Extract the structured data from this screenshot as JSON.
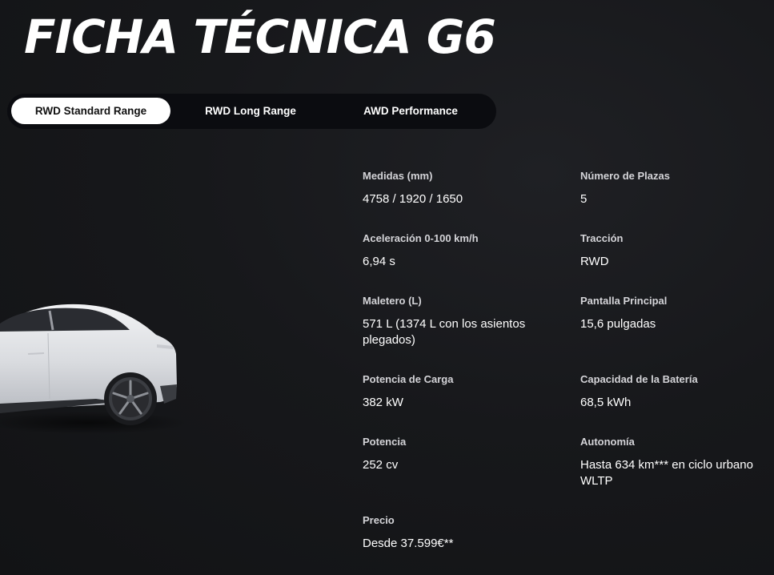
{
  "page": {
    "title": "FICHA TÉCNICA G6"
  },
  "tabs": [
    {
      "label": "RWD Standard Range",
      "active": true
    },
    {
      "label": "RWD Long Range",
      "active": false
    },
    {
      "label": "AWD Performance",
      "active": false
    }
  ],
  "specs": {
    "medidas": {
      "label": "Medidas (mm)",
      "value": "4758 / 1920 / 1650"
    },
    "plazas": {
      "label": "Número de Plazas",
      "value": "5"
    },
    "aceleracion": {
      "label": "Aceleración 0-100 km/h",
      "value": "6,94 s"
    },
    "traccion": {
      "label": "Tracción",
      "value": "RWD"
    },
    "maletero": {
      "label": "Maletero (L)",
      "value": "571 L (1374 L con los asientos plegados)"
    },
    "pantalla": {
      "label": "Pantalla Principal",
      "value": "15,6 pulgadas"
    },
    "potencia_carga": {
      "label": "Potencia de Carga",
      "value": "382 kW"
    },
    "bateria": {
      "label": "Capacidad de la Batería",
      "value": "68,5 kWh"
    },
    "potencia": {
      "label": "Potencia",
      "value": "252 cv"
    },
    "autonomia": {
      "label": "Autonomía",
      "value": "Hasta 634 km*** en ciclo urbano WLTP"
    },
    "precio": {
      "label": "Precio",
      "value": "Desde 37.599€**"
    }
  },
  "colors": {
    "background": "#16171a",
    "tab_bar": "#0b0c10",
    "active_tab": "#ffffff",
    "car_body": "#e6e7ea"
  }
}
